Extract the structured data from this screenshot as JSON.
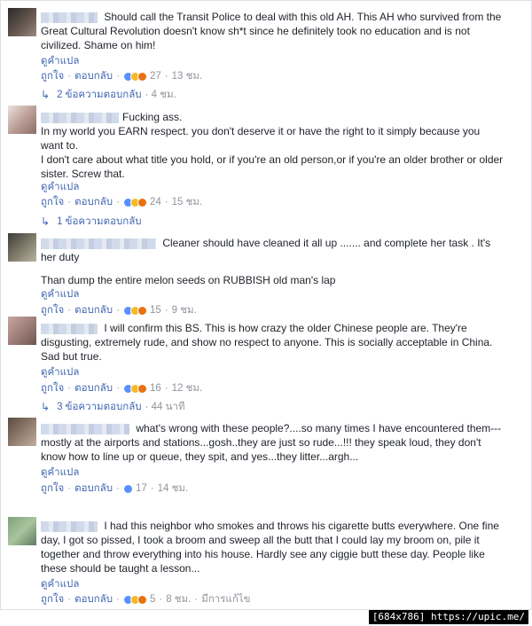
{
  "labels": {
    "translate": "ดูคำแปล",
    "like": "ถูกใจ",
    "reply": "ตอบกลับ",
    "dot": "·"
  },
  "comments": [
    {
      "text": [
        "Should call the Transit Police to deal with this old AH. This AH who survived from the Great Cultural Revolution doesn't know sh*t since he definitely took no education and is not civilized. Shame on him!"
      ],
      "reactions": [
        "like",
        "haha",
        "angry"
      ],
      "count": "27",
      "time": "13 ชม.",
      "replies": "2 ข้อความตอบกลับ",
      "replies_time": "4 ชม."
    },
    {
      "text": [
        "Fucking ass.",
        "In my world you EARN respect. you don't deserve it or have the right to it simply because you want to.",
        "I don't care about what title you hold, or if you're an old person,or if you're an older brother or older sister. Screw that."
      ],
      "reactions": [
        "like",
        "haha",
        "angry"
      ],
      "count": "24",
      "time": "15 ชม.",
      "replies": "1 ข้อความตอบกลับ",
      "replies_time": ""
    },
    {
      "text": [
        "Cleaner should have cleaned it all up ....... and complete her task . It's her duty",
        "Than dump the entire melon seeds on RUBBISH old man's lap"
      ],
      "reactions": [
        "like",
        "haha",
        "angry"
      ],
      "count": "15",
      "time": "9 ชม.",
      "replies": "",
      "replies_time": ""
    },
    {
      "text": [
        "I will confirm this BS. This is how crazy the older Chinese people are. They're disgusting, extremely rude, and show no respect to anyone. This is socially acceptable in China. Sad but true."
      ],
      "reactions": [
        "like",
        "haha",
        "angry"
      ],
      "count": "16",
      "time": "12 ชม.",
      "replies": "3 ข้อความตอบกลับ",
      "replies_time": "44 นาที"
    },
    {
      "text": [
        "what's wrong with these people?....so many times I have encountered them---mostly at the airports and stations...gosh..they are just so rude...!!! they speak loud, they don't know how to line up or queue, they spit, and yes...they litter...argh..."
      ],
      "reactions": [
        "like"
      ],
      "count": "17",
      "time": "14 ชม.",
      "replies": "",
      "replies_time": ""
    },
    {
      "text": [
        "I had this neighbor who smokes and throws his cigarette butts everywhere. One fine day, I got so pissed, I took a broom and sweep all the butt that I could lay my broom on, pile it together and throw everything into his house. Hardly see any ciggie butt these day. People like these should be taught a lesson..."
      ],
      "reactions": [
        "like",
        "haha",
        "angry"
      ],
      "count": "5",
      "time": "8 ชม.",
      "edited": "มีการแก้ไข",
      "replies": "",
      "replies_time": ""
    }
  ],
  "watermark": "[684x786] https://upic.me/"
}
